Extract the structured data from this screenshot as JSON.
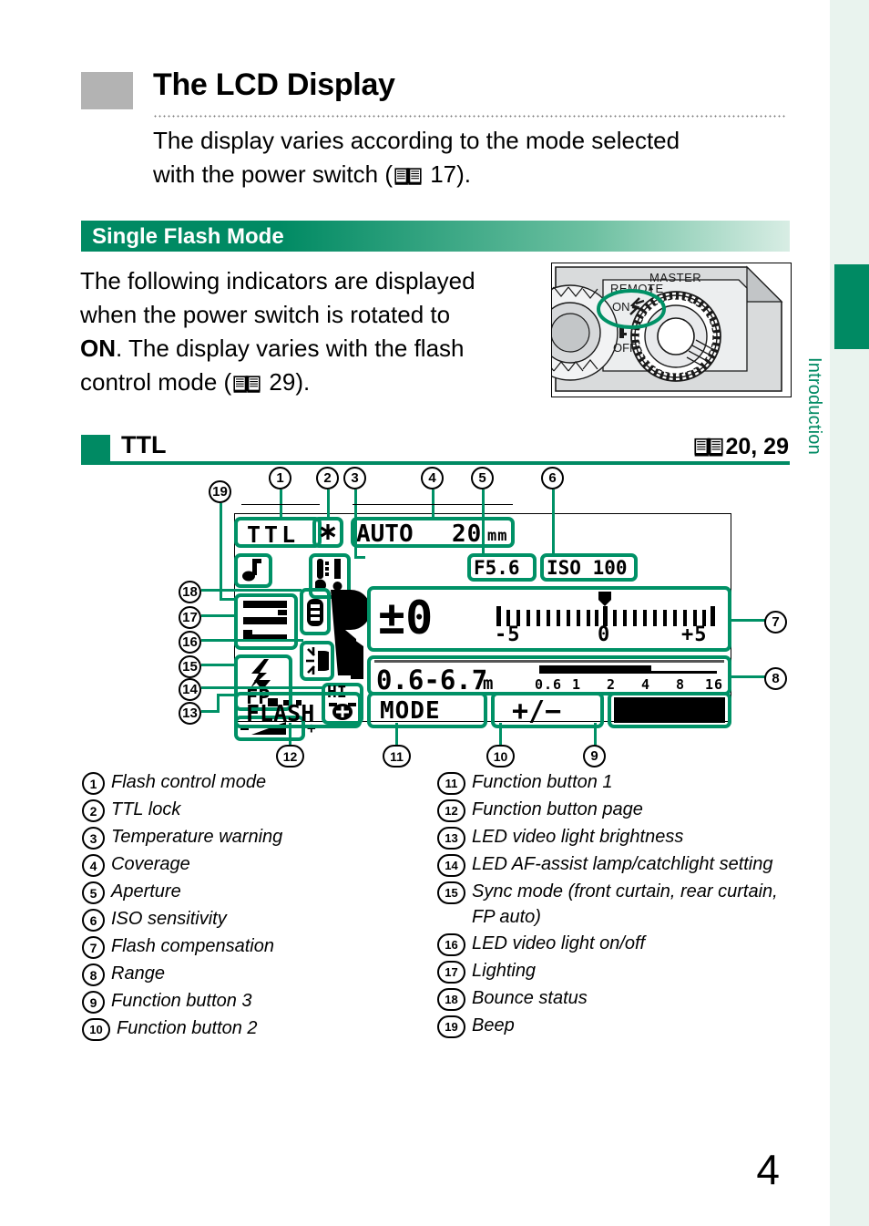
{
  "page": {
    "title": "The LCD Display",
    "intro": "The display varies according to the mode selected with the power switch (  17).",
    "intro_line1": "The display varies according to the mode selected",
    "intro_line2_a": "with the power switch (",
    "intro_line2_b": " 17).",
    "number": "4"
  },
  "tab": {
    "label": "Introduction",
    "color": "#008a63"
  },
  "section": {
    "band_label": "Single Flash Mode"
  },
  "body": {
    "line1": "The following indicators are displayed",
    "line2": "when the power switch is rotated to",
    "line3_bold": "ON",
    "line3_rest": ". The display varies with the flash",
    "line4_a": "control mode (",
    "line4_b": " 29)."
  },
  "camera": {
    "labels": {
      "remote": "REMOTE",
      "master": "MASTER",
      "on": "ON",
      "off": "OFF"
    }
  },
  "subheader": {
    "label": "TTL",
    "reference": "20, 29"
  },
  "lcd": {
    "flash_control_mode": "TTL",
    "ttl_lock": "✳",
    "coverage_auto": "AUTO",
    "coverage_value": "20",
    "coverage_unit": "mm",
    "aperture": "F5.6",
    "iso": "ISO 100",
    "compensation_value": "±0",
    "compensation_scale_min": "-5",
    "compensation_scale_mid": "0",
    "compensation_scale_max": "+5",
    "range_value": "0.6-6.7",
    "range_unit": "m",
    "range_ticks": [
      "0.6",
      "1",
      "2",
      "4",
      "8",
      "16"
    ],
    "sync_mode": "FP",
    "hi_label": "HI",
    "fn_page": "FLASH",
    "fn_button_1": "MODE",
    "fn_button_2": "+/−",
    "fn_button_3": ""
  },
  "callouts": [
    "1",
    "2",
    "3",
    "4",
    "5",
    "6",
    "7",
    "8",
    "9",
    "10",
    "11",
    "12",
    "13",
    "14",
    "15",
    "16",
    "17",
    "18",
    "19"
  ],
  "legend_left": [
    {
      "n": "1",
      "text": "Flash control mode"
    },
    {
      "n": "2",
      "text": "TTL lock"
    },
    {
      "n": "3",
      "text": "Temperature warning"
    },
    {
      "n": "4",
      "text": "Coverage"
    },
    {
      "n": "5",
      "text": "Aperture"
    },
    {
      "n": "6",
      "text": "ISO sensitivity"
    },
    {
      "n": "7",
      "text": "Flash compensation"
    },
    {
      "n": "8",
      "text": "Range"
    },
    {
      "n": "9",
      "text": "Function button 3"
    },
    {
      "n": "10",
      "text": "Function button 2"
    }
  ],
  "legend_right": [
    {
      "n": "11",
      "text": "Function button 1"
    },
    {
      "n": "12",
      "text": "Function button page"
    },
    {
      "n": "13",
      "text": "LED video light brightness"
    },
    {
      "n": "14",
      "text": "LED AF-assist lamp/catchlight setting"
    },
    {
      "n": "15",
      "text": "Sync mode (front curtain, rear curtain,",
      "text2": "FP auto)"
    },
    {
      "n": "16",
      "text": "LED video light on/off"
    },
    {
      "n": "17",
      "text": "Lighting"
    },
    {
      "n": "18",
      "text": "Bounce status"
    },
    {
      "n": "19",
      "text": "Beep"
    }
  ],
  "colors": {
    "accent": "#008a63",
    "highlight": "#009166",
    "tab_bg": "#e9f3ee",
    "swatch": "#b3b3b3"
  }
}
